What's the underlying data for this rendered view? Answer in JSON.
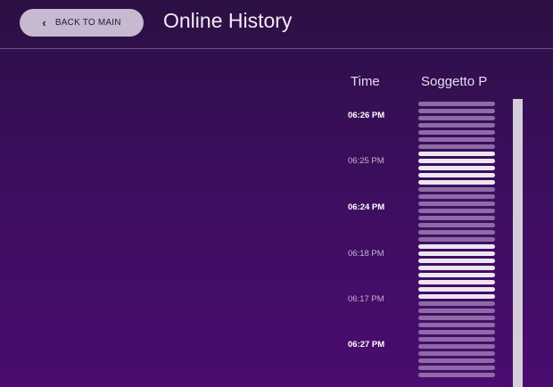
{
  "header": {
    "back_label": "BACK TO MAIN",
    "title": "Online History"
  },
  "columns": {
    "time": "Time",
    "subject": "Soggetto P"
  },
  "entries": [
    {
      "time": "06:26 PM",
      "bold": true,
      "slots": [
        false,
        false,
        false,
        false,
        false,
        false
      ]
    },
    {
      "time": "06:25 PM",
      "bold": false,
      "slots": [
        false,
        true,
        true,
        true,
        true,
        true,
        false
      ]
    },
    {
      "time": "06:24 PM",
      "bold": true,
      "slots": [
        false,
        false,
        false,
        false,
        false,
        false
      ]
    },
    {
      "time": "06:18 PM",
      "bold": false,
      "slots": [
        false,
        true,
        true,
        true,
        true,
        true,
        true
      ]
    },
    {
      "time": "06:17 PM",
      "bold": false,
      "slots": [
        true,
        true,
        false,
        false,
        false,
        false
      ]
    },
    {
      "time": "06:27 PM",
      "bold": true,
      "slots": [
        false,
        false,
        false,
        false,
        false,
        false,
        false
      ]
    }
  ]
}
